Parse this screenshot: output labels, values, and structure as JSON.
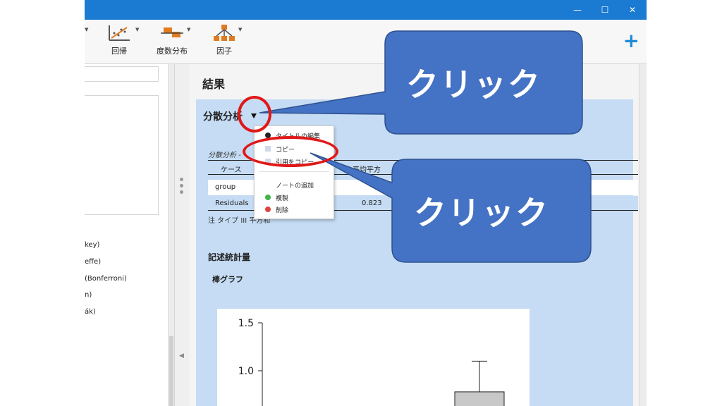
{
  "toolbar": {
    "items": [
      {
        "label": "回帰",
        "icon": "regression-icon"
      },
      {
        "label": "度数分布",
        "icon": "frequencies-icon"
      },
      {
        "label": "因子",
        "icon": "factor-icon"
      }
    ],
    "add_icon": "plus-icon"
  },
  "window_controls": [
    "minimize",
    "maximize",
    "close"
  ],
  "left_panel": {
    "options": [
      "key)",
      "effe)",
      "(Bonferroni)",
      "n)",
      "ák)"
    ]
  },
  "results": {
    "title": "結果",
    "anova_heading": "分散分析",
    "table_caption": "分散分析 - ",
    "header_case": "ケース",
    "header_mean_sq": "平均平方",
    "rows": [
      {
        "case": "group",
        "value": ""
      },
      {
        "case": "Residuals",
        "value": "0.823"
      }
    ],
    "note": "注 タイプ III 平方和",
    "descriptives_heading": "記述統計量",
    "barchart_heading": "棒グラフ"
  },
  "chart_data": {
    "type": "bar",
    "yticks": [
      "1.5",
      "1.0"
    ],
    "ylim": [
      0.7,
      1.5
    ],
    "categories": [
      "",
      ""
    ],
    "values": [
      null,
      0.78
    ],
    "error_upper": [
      null,
      1.1
    ],
    "colors": {
      "bar": "#c8c8c8",
      "axis": "#222222"
    }
  },
  "context_menu": {
    "items": [
      {
        "label": "タイトルの編集",
        "icon": "edit-icon"
      },
      {
        "label": "コピー",
        "icon": "copy-icon"
      },
      {
        "label": "引用をコピー",
        "icon": "citation-icon"
      },
      {
        "label": "ノートの追加",
        "icon": ""
      },
      {
        "label": "複製",
        "icon": "duplicate-icon"
      },
      {
        "label": "削除",
        "icon": "delete-icon"
      }
    ]
  },
  "annotations": {
    "callout_label": "クリック",
    "callout_color": "#4472c4",
    "ring_color": "#e01818"
  },
  "colors": {
    "titlebar": "#1b7ad1",
    "panel": "#c5dcf4",
    "accent_plus": "#1b8ad6"
  }
}
